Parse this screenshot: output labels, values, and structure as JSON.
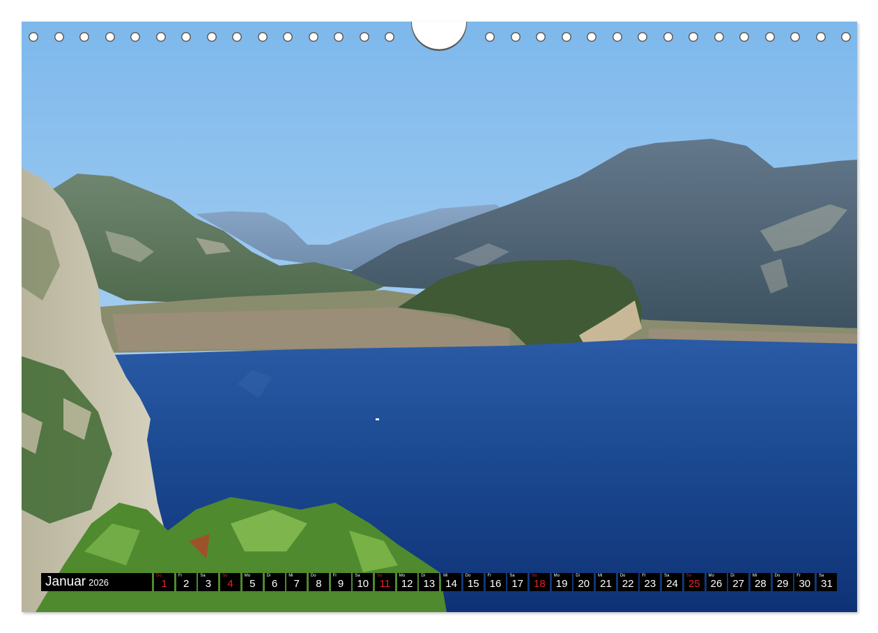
{
  "calendar": {
    "month": "Januar",
    "year": "2026",
    "days": [
      {
        "weekday": "Do",
        "day": "1",
        "holiday": true
      },
      {
        "weekday": "Fr",
        "day": "2",
        "holiday": false
      },
      {
        "weekday": "Sa",
        "day": "3",
        "holiday": false
      },
      {
        "weekday": "So",
        "day": "4",
        "holiday": true
      },
      {
        "weekday": "Mo",
        "day": "5",
        "holiday": false
      },
      {
        "weekday": "Di",
        "day": "6",
        "holiday": false
      },
      {
        "weekday": "Mi",
        "day": "7",
        "holiday": false
      },
      {
        "weekday": "Do",
        "day": "8",
        "holiday": false
      },
      {
        "weekday": "Fr",
        "day": "9",
        "holiday": false
      },
      {
        "weekday": "Sa",
        "day": "10",
        "holiday": false
      },
      {
        "weekday": "So",
        "day": "11",
        "holiday": true
      },
      {
        "weekday": "Mo",
        "day": "12",
        "holiday": false
      },
      {
        "weekday": "Di",
        "day": "13",
        "holiday": false
      },
      {
        "weekday": "Mi",
        "day": "14",
        "holiday": false
      },
      {
        "weekday": "Do",
        "day": "15",
        "holiday": false
      },
      {
        "weekday": "Fr",
        "day": "16",
        "holiday": false
      },
      {
        "weekday": "Sa",
        "day": "17",
        "holiday": false
      },
      {
        "weekday": "So",
        "day": "18",
        "holiday": true
      },
      {
        "weekday": "Mo",
        "day": "19",
        "holiday": false
      },
      {
        "weekday": "Di",
        "day": "20",
        "holiday": false
      },
      {
        "weekday": "Mi",
        "day": "21",
        "holiday": false
      },
      {
        "weekday": "Do",
        "day": "22",
        "holiday": false
      },
      {
        "weekday": "Fr",
        "day": "23",
        "holiday": false
      },
      {
        "weekday": "Sa",
        "day": "24",
        "holiday": false
      },
      {
        "weekday": "So",
        "day": "25",
        "holiday": true
      },
      {
        "weekday": "Mo",
        "day": "26",
        "holiday": false
      },
      {
        "weekday": "Di",
        "day": "27",
        "holiday": false
      },
      {
        "weekday": "Mi",
        "day": "28",
        "holiday": false
      },
      {
        "weekday": "Do",
        "day": "29",
        "holiday": false
      },
      {
        "weekday": "Fr",
        "day": "30",
        "holiday": false
      },
      {
        "weekday": "Sa",
        "day": "31",
        "holiday": false
      }
    ]
  },
  "colors": {
    "strip_background": "#000000",
    "strip_text": "#ffffff",
    "holiday_text": "#e2232a",
    "sky": "#8fc2ee",
    "lake": "#1c4b93"
  },
  "photo": {
    "icon": "lake-garda-landscape-photo"
  }
}
